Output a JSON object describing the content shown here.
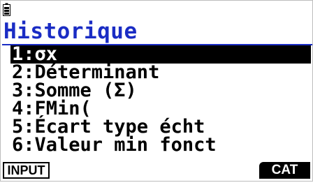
{
  "status_bar": {
    "battery_icon": "battery-icon"
  },
  "menu": {
    "title": "Historique",
    "items": [
      {
        "label": "1:σx",
        "selected": true
      },
      {
        "label": "2:Déterminant",
        "selected": false
      },
      {
        "label": "3:Somme (Σ)",
        "selected": false
      },
      {
        "label": "4:FMin(",
        "selected": false
      },
      {
        "label": "5:Écart type écht",
        "selected": false
      },
      {
        "label": "6:Valeur min fonct",
        "selected": false
      }
    ]
  },
  "function_keys": {
    "f1": "INPUT",
    "f6": "CAT"
  },
  "colors": {
    "title": "#1a2cc4",
    "selection": "#000000"
  }
}
